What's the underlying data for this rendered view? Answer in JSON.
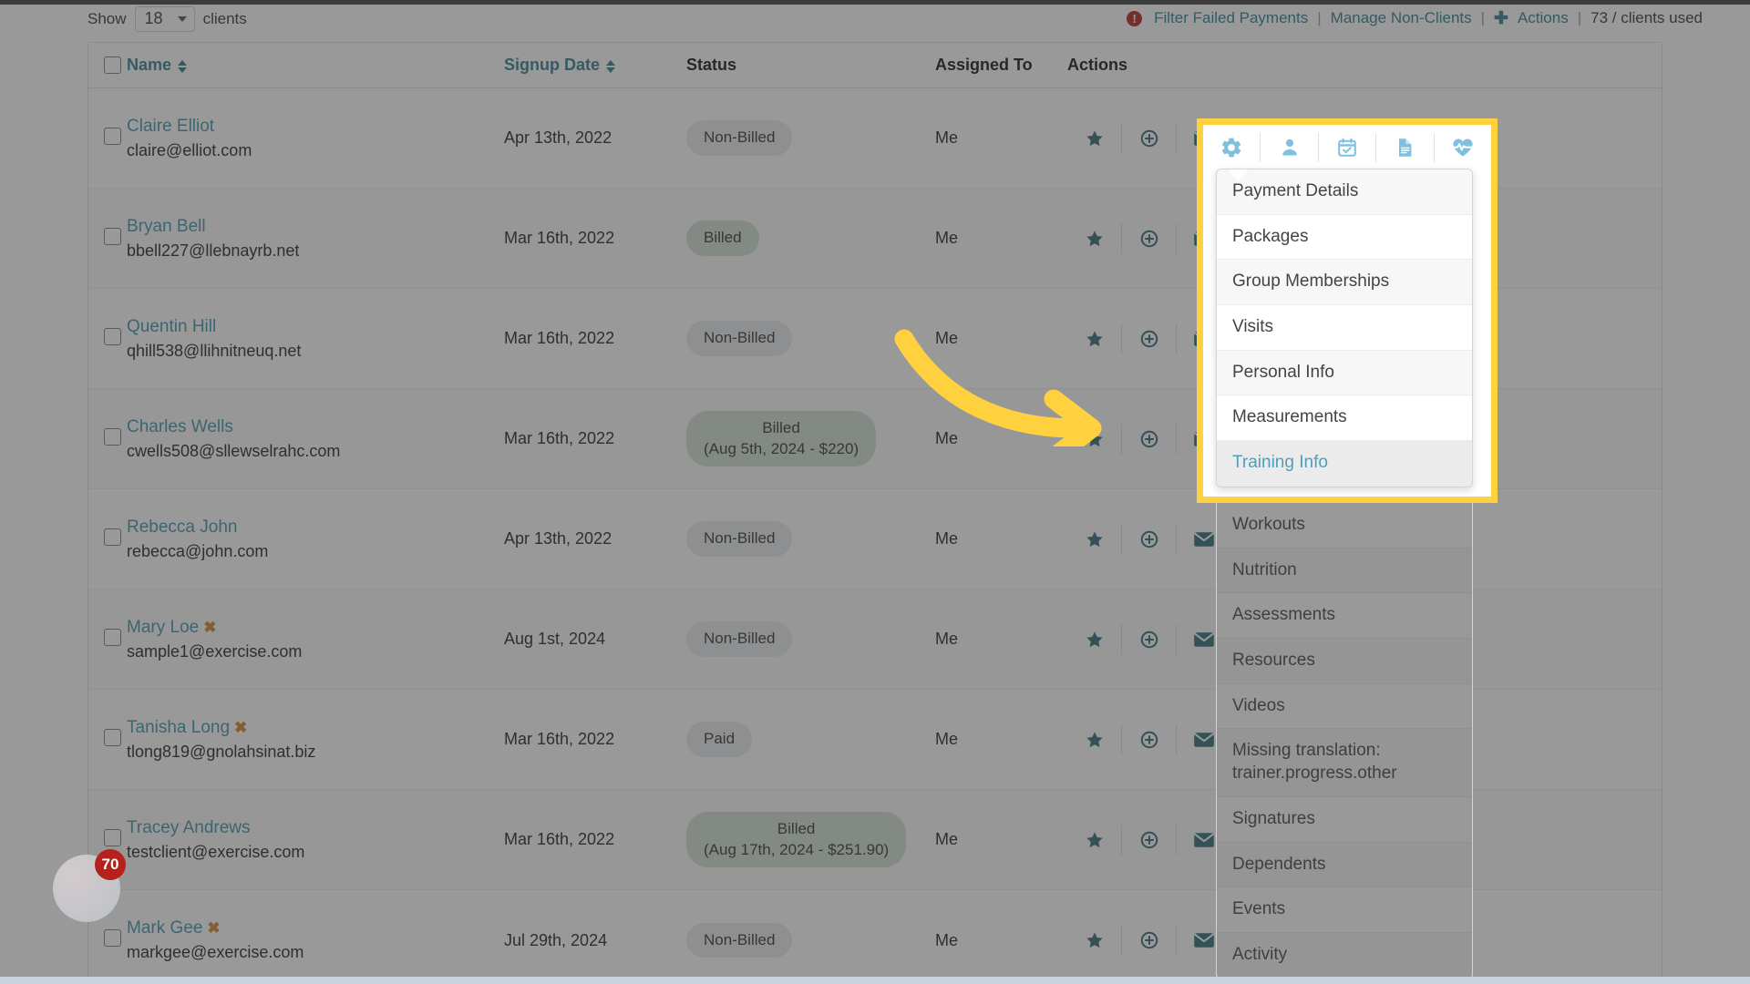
{
  "toolbar": {
    "show_label": "Show",
    "show_value": "18",
    "clients_label": "clients",
    "filter_failed_payments": "Filter Failed Payments",
    "manage_non_clients": "Manage Non-Clients",
    "actions": "Actions",
    "clients_used": "73 / clients used",
    "separator": "|",
    "warn_glyph": "!",
    "plus_glyph": "✚"
  },
  "table": {
    "headers": {
      "name": "Name",
      "signup_date": "Signup Date",
      "status": "Status",
      "assigned_to": "Assigned To",
      "actions": "Actions"
    },
    "rows": [
      {
        "name": "Claire Elliot",
        "flagged": false,
        "email": "claire@elliot.com",
        "date": "Apr 13th, 2022",
        "status": "Non-Billed",
        "status_sub": "",
        "status_kind": "nonbilled",
        "assigned_to": "Me"
      },
      {
        "name": "Bryan Bell",
        "flagged": false,
        "email": "bbell227@llebnayrb.net",
        "date": "Mar 16th, 2022",
        "status": "Billed",
        "status_sub": "",
        "status_kind": "billed",
        "assigned_to": "Me"
      },
      {
        "name": "Quentin Hill",
        "flagged": false,
        "email": "qhill538@llihnitneuq.net",
        "date": "Mar 16th, 2022",
        "status": "Non-Billed",
        "status_sub": "",
        "status_kind": "nonbilled",
        "assigned_to": "Me"
      },
      {
        "name": "Charles Wells",
        "flagged": false,
        "email": "cwells508@sllewselrahc.com",
        "date": "Mar 16th, 2022",
        "status": "Billed",
        "status_sub": "(Aug 5th, 2024 - $220)",
        "status_kind": "billed",
        "assigned_to": "Me"
      },
      {
        "name": "Rebecca John",
        "flagged": false,
        "email": "rebecca@john.com",
        "date": "Apr 13th, 2022",
        "status": "Non-Billed",
        "status_sub": "",
        "status_kind": "nonbilled",
        "assigned_to": "Me"
      },
      {
        "name": "Mary Loe",
        "flagged": true,
        "email": "sample1@exercise.com",
        "date": "Aug 1st, 2024",
        "status": "Non-Billed",
        "status_sub": "",
        "status_kind": "nonbilled",
        "assigned_to": "Me"
      },
      {
        "name": "Tanisha Long",
        "flagged": true,
        "email": "tlong819@gnolahsinat.biz",
        "date": "Mar 16th, 2022",
        "status": "Paid",
        "status_sub": "",
        "status_kind": "nonbilled",
        "assigned_to": "Me"
      },
      {
        "name": "Tracey Andrews",
        "flagged": false,
        "email": "testclient@exercise.com",
        "date": "Mar 16th, 2022",
        "status": "Billed",
        "status_sub": "(Aug 17th, 2024 - $251.90)",
        "status_kind": "billed",
        "assigned_to": "Me"
      },
      {
        "name": "Mark Gee",
        "flagged": true,
        "email": "markgee@exercise.com",
        "date": "Jul 29th, 2024",
        "status": "Non-Billed",
        "status_sub": "",
        "status_kind": "nonbilled",
        "assigned_to": "Me"
      }
    ],
    "flag_glyph": "✖",
    "row_action_icons": [
      "star-icon",
      "plus-circle-icon",
      "envelope-icon"
    ]
  },
  "popup": {
    "icon_bar": [
      "gear-icon",
      "person-icon",
      "calendar-check-icon",
      "document-icon",
      "heartbeat-icon"
    ],
    "menu_items_highlighted": [
      "Payment Details",
      "Packages",
      "Group Memberships",
      "Visits",
      "Personal Info",
      "Measurements",
      "Training Info"
    ],
    "menu_items_below": [
      "Workouts",
      "Nutrition",
      "Assessments",
      "Resources",
      "Videos",
      "Missing translation: trainer.progress.other",
      "Signatures",
      "Dependents",
      "Events",
      "Activity"
    ],
    "active_item": "Training Info"
  },
  "widget": {
    "badge_count": "70"
  },
  "colors": {
    "accent_link": "#2e7c8c",
    "name_link": "#3e93ab",
    "highlight_yellow": "#ffd13f",
    "badge_billed": "#cfe0d2",
    "badge_default": "#e8eaec",
    "warn_red": "#b32020",
    "flag_orange": "#d4842a",
    "icon_blue": "#7ec0dd",
    "action_icon": "#2d6a78"
  }
}
